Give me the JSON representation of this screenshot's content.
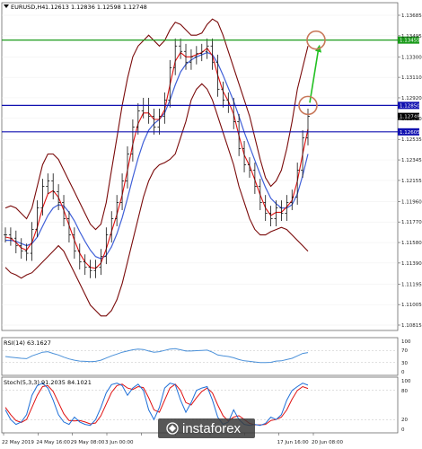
{
  "header": {
    "symbol_info": "EURUSD,H4",
    "ohlc": "1.12613 1.12836 1.12598 1.12748"
  },
  "price_axis": {
    "ticks": [
      "1.13685",
      "1.13495",
      "1.13300",
      "1.13110",
      "1.12920",
      "1.12730",
      "1.12535",
      "1.12345",
      "1.12155",
      "1.11960",
      "1.11770",
      "1.11580",
      "1.11390",
      "1.11195",
      "1.11005",
      "1.10815"
    ],
    "ylim": [
      1.10815,
      1.13685
    ]
  },
  "levels": [
    {
      "label": "1.13455",
      "value": 1.13455,
      "color": "#1a9a1a"
    },
    {
      "label": "1.12850",
      "value": 1.1285,
      "color": "#1010b0"
    },
    {
      "label": "1.12605",
      "value": 1.12605,
      "color": "#1010b0"
    }
  ],
  "current_price": {
    "label": "1.12748",
    "value": 1.12748
  },
  "time_axis": {
    "labels": [
      "22 May 2019",
      "24 May 16:00",
      "29 May 08:00",
      "3 Jun 00:00",
      "",
      "",
      "",
      "",
      "17 Jun 16:00",
      "20 Jun 08:00"
    ]
  },
  "rsi": {
    "title": "RSI(14) 63.1627",
    "ticks": [
      "100",
      "70",
      "30",
      "0"
    ]
  },
  "stoch": {
    "title": "Stoch(5,3,3) 91.2035 84.1021",
    "ticks": [
      "100",
      "80",
      "20",
      "0"
    ]
  },
  "watermark": {
    "text": "instaforex"
  },
  "colors": {
    "bollinger": "#7a0a0a",
    "ma_fast": "#e01010",
    "ma_slow": "#4060d8",
    "rsi_line": "#4a90d9",
    "stoch_main": "#1e6fd8",
    "stoch_signal": "#e01010",
    "arrow": "#22c022",
    "circle": "#c8785a",
    "watermark_bg": "#3a3a3a"
  },
  "chart_data": [
    {
      "type": "line",
      "title": "EURUSD,H4",
      "ylim": [
        1.10815,
        1.13685
      ],
      "x": [
        0,
        6,
        12,
        18,
        24,
        30,
        36,
        42,
        48,
        54,
        60,
        66,
        72,
        78,
        84,
        90,
        96,
        102,
        108,
        114,
        120,
        126,
        132,
        138,
        144,
        150,
        156,
        162,
        168,
        174,
        180,
        186,
        192,
        198,
        204,
        210,
        216,
        222,
        228,
        234,
        240,
        246,
        252,
        258,
        264,
        270,
        276,
        282,
        288,
        294,
        300,
        306,
        312,
        318,
        324,
        330,
        336,
        342
      ],
      "series": [
        {
          "name": "price",
          "values": [
            1.1165,
            1.1162,
            1.1155,
            1.115,
            1.1148,
            1.117,
            1.119,
            1.121,
            1.1215,
            1.1205,
            1.1195,
            1.118,
            1.1165,
            1.115,
            1.114,
            1.1135,
            1.1132,
            1.1135,
            1.1145,
            1.1165,
            1.118,
            1.1195,
            1.1215,
            1.124,
            1.1265,
            1.128,
            1.1285,
            1.1275,
            1.1265,
            1.1275,
            1.129,
            1.132,
            1.134,
            1.1335,
            1.1325,
            1.133,
            1.1333,
            1.1335,
            1.134,
            1.1325,
            1.13,
            1.129,
            1.1285,
            1.127,
            1.1245,
            1.123,
            1.1225,
            1.121,
            1.1195,
            1.1185,
            1.118,
            1.119,
            1.1185,
            1.1195,
            1.12,
            1.1225,
            1.1255,
            1.1275
          ]
        },
        {
          "name": "ma_fast",
          "values": [
            1.1163,
            1.1162,
            1.1158,
            1.1153,
            1.1151,
            1.1158,
            1.1172,
            1.119,
            1.1203,
            1.1206,
            1.12,
            1.1188,
            1.1174,
            1.116,
            1.1148,
            1.114,
            1.1135,
            1.1134,
            1.1139,
            1.1152,
            1.1168,
            1.1184,
            1.1202,
            1.1225,
            1.1249,
            1.1268,
            1.1278,
            1.1278,
            1.1272,
            1.1272,
            1.1281,
            1.1304,
            1.1326,
            1.1334,
            1.133,
            1.133,
            1.1332,
            1.1334,
            1.1338,
            1.1331,
            1.1313,
            1.1298,
            1.1289,
            1.1277,
            1.1257,
            1.1239,
            1.1229,
            1.1216,
            1.1202,
            1.119,
            1.1183,
            1.1186,
            1.1186,
            1.1191,
            1.1197,
            1.1215,
            1.124,
            1.1263
          ]
        },
        {
          "name": "ma_slow",
          "values": [
            1.116,
            1.116,
            1.1159,
            1.1157,
            1.1155,
            1.1157,
            1.1163,
            1.1173,
            1.1183,
            1.119,
            1.1193,
            1.1192,
            1.1186,
            1.1178,
            1.1168,
            1.1159,
            1.1151,
            1.1145,
            1.1143,
            1.1146,
            1.1154,
            1.1166,
            1.1181,
            1.1199,
            1.1218,
            1.1236,
            1.1251,
            1.1262,
            1.1268,
            1.1272,
            1.1278,
            1.129,
            1.1304,
            1.1316,
            1.1323,
            1.1327,
            1.133,
            1.1332,
            1.1334,
            1.1332,
            1.1324,
            1.1313,
            1.1301,
            1.1289,
            1.1275,
            1.126,
            1.1247,
            1.1234,
            1.1221,
            1.1209,
            1.1199,
            1.1194,
            1.119,
            1.119,
            1.1193,
            1.1203,
            1.122,
            1.124
          ]
        },
        {
          "name": "bb_upper",
          "values": [
            1.119,
            1.1192,
            1.119,
            1.1185,
            1.118,
            1.119,
            1.121,
            1.123,
            1.124,
            1.124,
            1.1235,
            1.1225,
            1.1215,
            1.1205,
            1.1195,
            1.1185,
            1.1175,
            1.117,
            1.1175,
            1.1195,
            1.1225,
            1.1255,
            1.1285,
            1.131,
            1.133,
            1.134,
            1.1345,
            1.135,
            1.1345,
            1.134,
            1.1345,
            1.1355,
            1.1362,
            1.136,
            1.1355,
            1.135,
            1.135,
            1.1352,
            1.136,
            1.1365,
            1.1362,
            1.135,
            1.1335,
            1.132,
            1.1305,
            1.129,
            1.1275,
            1.1255,
            1.1235,
            1.1218,
            1.121,
            1.1215,
            1.1225,
            1.1245,
            1.127,
            1.13,
            1.132,
            1.134
          ]
        },
        {
          "name": "bb_lower",
          "values": [
            1.1135,
            1.113,
            1.1128,
            1.1125,
            1.1128,
            1.113,
            1.1135,
            1.114,
            1.1145,
            1.115,
            1.1155,
            1.115,
            1.114,
            1.113,
            1.112,
            1.111,
            1.11,
            1.1095,
            1.109,
            1.109,
            1.1095,
            1.1105,
            1.112,
            1.114,
            1.116,
            1.118,
            1.12,
            1.1215,
            1.1225,
            1.123,
            1.1232,
            1.1235,
            1.124,
            1.1255,
            1.127,
            1.129,
            1.13,
            1.1305,
            1.13,
            1.129,
            1.1275,
            1.126,
            1.1245,
            1.123,
            1.121,
            1.1195,
            1.118,
            1.117,
            1.1165,
            1.1165,
            1.1168,
            1.117,
            1.1172,
            1.117,
            1.1165,
            1.116,
            1.1155,
            1.115
          ]
        }
      ]
    },
    {
      "type": "line",
      "title": "RSI(14) 63.1627",
      "ylim": [
        0,
        100
      ],
      "x": [
        0,
        6,
        12,
        18,
        24,
        30,
        36,
        42,
        48,
        54,
        60,
        66,
        72,
        78,
        84,
        90,
        96,
        102,
        108,
        114,
        120,
        126,
        132,
        138,
        144,
        150,
        156,
        162,
        168,
        174,
        180,
        186,
        192,
        198,
        204,
        210,
        216,
        222,
        228,
        234,
        240,
        246,
        252,
        258,
        264,
        270,
        276,
        282,
        288,
        294,
        300,
        306,
        312,
        318,
        324,
        330,
        336,
        342
      ],
      "series": [
        {
          "name": "RSI",
          "values": [
            50,
            48,
            46,
            44,
            43,
            52,
            58,
            64,
            66,
            60,
            55,
            48,
            42,
            38,
            35,
            34,
            33,
            34,
            38,
            45,
            52,
            58,
            64,
            68,
            72,
            74,
            73,
            68,
            64,
            66,
            70,
            74,
            76,
            72,
            68,
            68,
            69,
            70,
            71,
            64,
            55,
            52,
            50,
            46,
            40,
            36,
            34,
            32,
            30,
            30,
            31,
            35,
            36,
            40,
            44,
            52,
            60,
            63
          ]
        }
      ]
    },
    {
      "type": "line",
      "title": "Stoch(5,3,3) 91.2035 84.1021",
      "ylim": [
        0,
        100
      ],
      "x": [
        0,
        6,
        12,
        18,
        24,
        30,
        36,
        42,
        48,
        54,
        60,
        66,
        72,
        78,
        84,
        90,
        96,
        102,
        108,
        114,
        120,
        126,
        132,
        138,
        144,
        150,
        156,
        162,
        168,
        174,
        180,
        186,
        192,
        198,
        204,
        210,
        216,
        222,
        228,
        234,
        240,
        246,
        252,
        258,
        264,
        270,
        276,
        282,
        288,
        294,
        300,
        306,
        312,
        318,
        324,
        330,
        336,
        342
      ],
      "series": [
        {
          "name": "Main",
          "values": [
            40,
            20,
            10,
            15,
            30,
            70,
            90,
            95,
            85,
            60,
            30,
            15,
            10,
            25,
            15,
            10,
            8,
            20,
            45,
            75,
            92,
            95,
            90,
            70,
            85,
            93,
            80,
            40,
            20,
            45,
            85,
            95,
            92,
            60,
            35,
            55,
            80,
            85,
            88,
            60,
            25,
            10,
            15,
            40,
            20,
            10,
            8,
            10,
            8,
            12,
            25,
            20,
            30,
            60,
            80,
            88,
            95,
            91
          ]
        },
        {
          "name": "Signal",
          "values": [
            45,
            30,
            18,
            14,
            20,
            45,
            70,
            88,
            90,
            78,
            55,
            32,
            18,
            17,
            18,
            15,
            11,
            13,
            28,
            52,
            76,
            90,
            93,
            85,
            82,
            88,
            86,
            65,
            40,
            35,
            60,
            85,
            93,
            80,
            55,
            50,
            65,
            78,
            85,
            75,
            50,
            28,
            17,
            25,
            28,
            20,
            12,
            9,
            9,
            10,
            18,
            20,
            25,
            40,
            62,
            80,
            88,
            84
          ]
        }
      ]
    }
  ]
}
